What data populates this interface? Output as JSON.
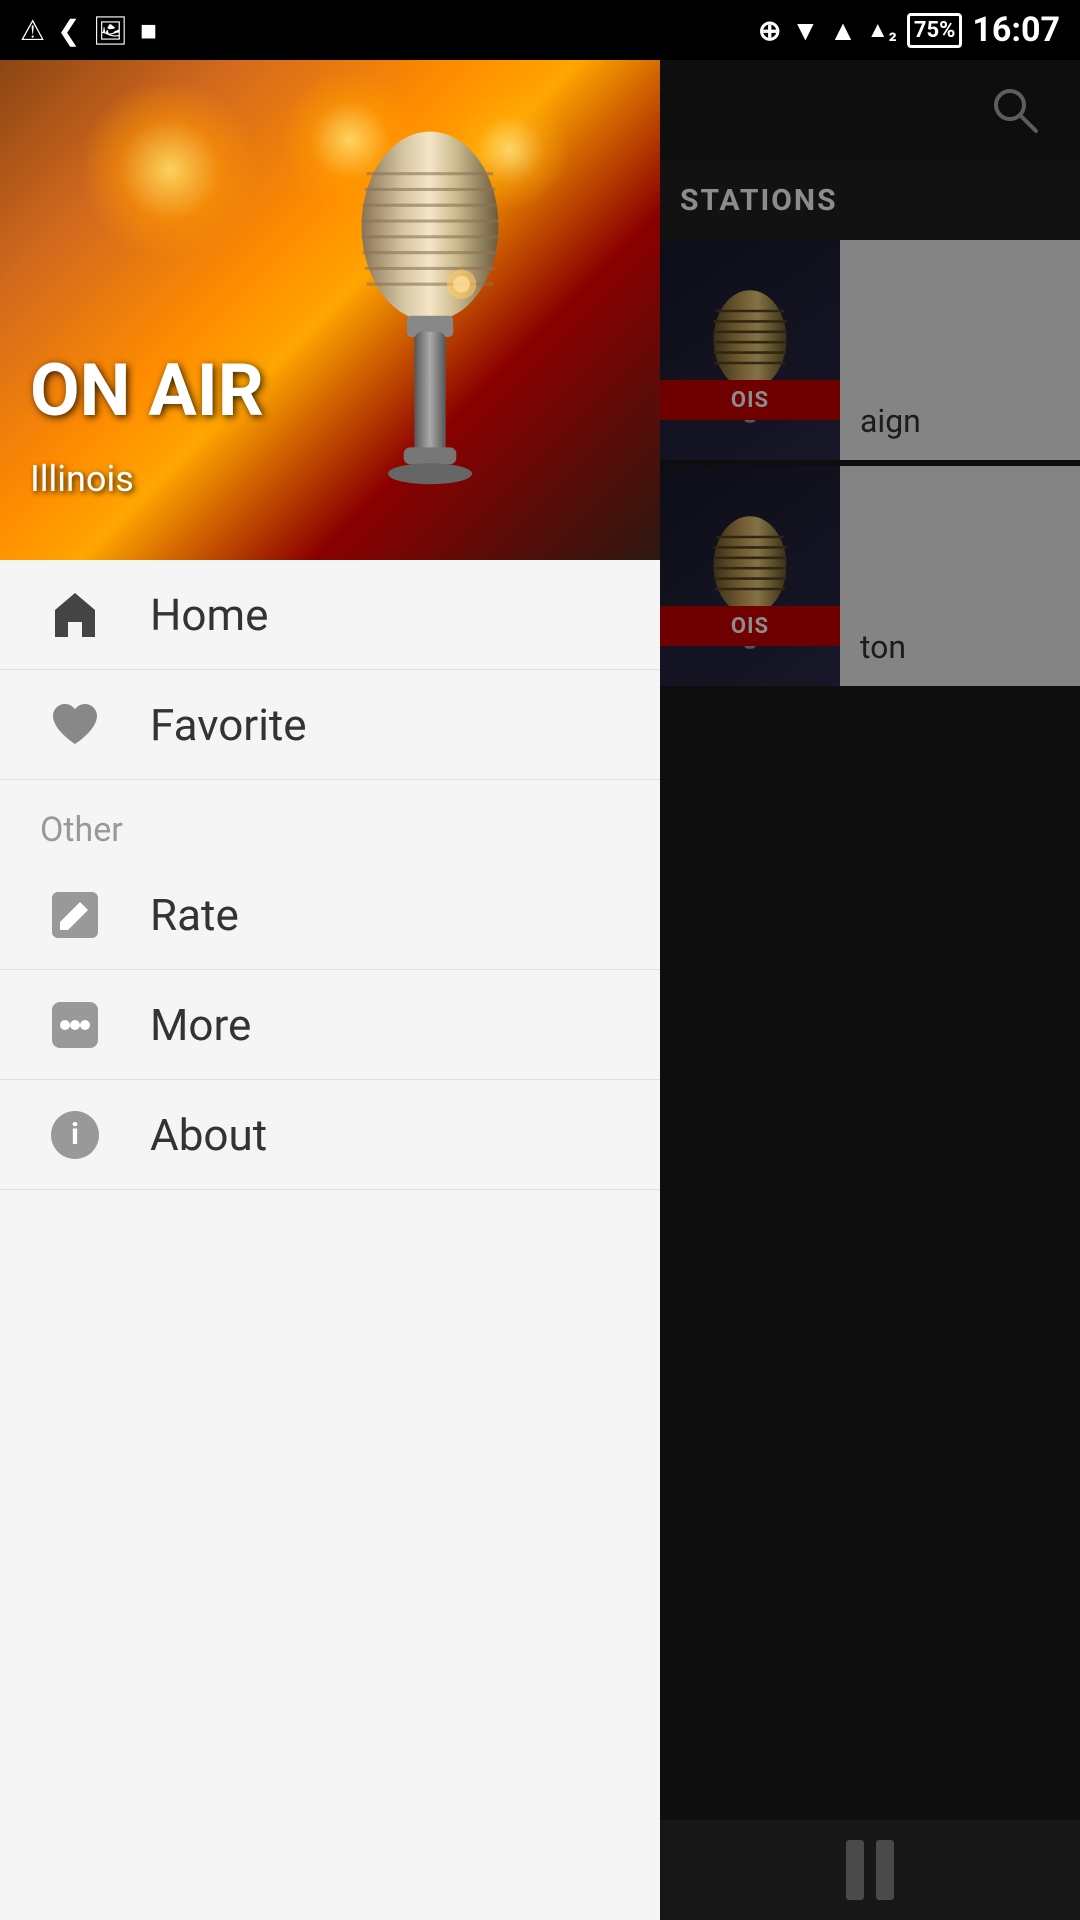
{
  "statusBar": {
    "time": "16:07",
    "battery": "75%",
    "icons": [
      "notification",
      "back",
      "image",
      "stop",
      "add-circle",
      "wifi",
      "signal",
      "signal2",
      "battery"
    ]
  },
  "drawer": {
    "heroImage": {
      "onAirText": "ON\nAIR",
      "stationName": "Illinois"
    },
    "menuItems": [
      {
        "id": "home",
        "label": "Home",
        "icon": "home"
      },
      {
        "id": "favorite",
        "label": "Favorite",
        "icon": "heart"
      }
    ],
    "otherSection": {
      "header": "Other",
      "items": [
        {
          "id": "rate",
          "label": "Rate",
          "icon": "edit"
        },
        {
          "id": "more",
          "label": "More",
          "icon": "more"
        },
        {
          "id": "about",
          "label": "About",
          "icon": "info"
        }
      ]
    }
  },
  "rightPanel": {
    "appTitle": "STATIONS",
    "stations": [
      {
        "id": 1,
        "redBarText": "OIS",
        "location": "aign"
      },
      {
        "id": 2,
        "redBarText": "OIS",
        "location": "ton"
      }
    ]
  }
}
